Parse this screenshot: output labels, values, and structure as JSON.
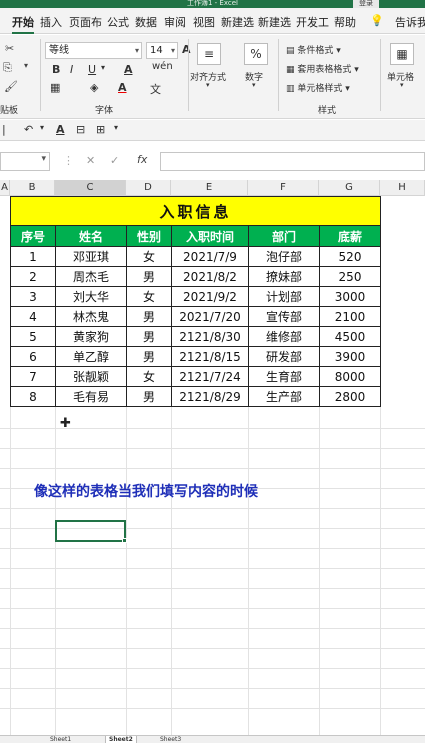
{
  "window": {
    "title": "工作簿1 - Excel",
    "login_label": "登录"
  },
  "tabs": [
    {
      "label": "开始",
      "active": true
    },
    {
      "label": "插入"
    },
    {
      "label": "页面布"
    },
    {
      "label": "公式"
    },
    {
      "label": "数据"
    },
    {
      "label": "审阅"
    },
    {
      "label": "视图"
    },
    {
      "label": "新建选"
    },
    {
      "label": "新建选"
    },
    {
      "label": "开发工"
    },
    {
      "label": "帮助"
    },
    {
      "label": "告诉我"
    }
  ],
  "ribbon": {
    "font_name": "等线",
    "font_size": "14",
    "group_clipboard": "贴板",
    "group_font": "字体",
    "group_styles": "样式",
    "align_label": "对齐方式",
    "number_label": "数字",
    "cond_format": "条件格式",
    "table_format": "套用表格格式",
    "cell_styles": "单元格样式",
    "cells_label": "单元格",
    "bold": "B",
    "italic": "I",
    "underline": "U",
    "grow_font": "A",
    "shrink_font": "A",
    "phonetic": "wén"
  },
  "formula_bar": {
    "fx": "fx",
    "name_value": "",
    "formula_value": ""
  },
  "columns": [
    "A",
    "B",
    "C",
    "D",
    "E",
    "F",
    "G",
    "H"
  ],
  "table": {
    "title": "入职信息",
    "headers": [
      "序号",
      "姓名",
      "性别",
      "入职时间",
      "部门",
      "底薪"
    ],
    "rows": [
      [
        "1",
        "邓亚琪",
        "女",
        "2021/7/9",
        "泡仔部",
        "520"
      ],
      [
        "2",
        "周杰毛",
        "男",
        "2021/8/2",
        "撩妹部",
        "250"
      ],
      [
        "3",
        "刘大华",
        "女",
        "2021/9/2",
        "计划部",
        "3000"
      ],
      [
        "4",
        "林杰鬼",
        "男",
        "2021/7/20",
        "宣传部",
        "2100"
      ],
      [
        "5",
        "黄家狗",
        "男",
        "2121/8/30",
        "维修部",
        "4500"
      ],
      [
        "6",
        "单乙醇",
        "男",
        "2121/8/15",
        "研发部",
        "3900"
      ],
      [
        "7",
        "张靓颖",
        "女",
        "2121/7/24",
        "生育部",
        "8000"
      ],
      [
        "8",
        "毛有易",
        "男",
        "2121/8/29",
        "生产部",
        "2800"
      ]
    ]
  },
  "note_text": "像这样的表格当我们填写内容的时候",
  "sheets": [
    "Sheet1",
    "Sheet2",
    "Sheet3"
  ],
  "colors": {
    "excel_green": "#217346",
    "title_fill": "#ffff00",
    "header_fill": "#00b050",
    "note_blue": "#1f2fb8"
  }
}
